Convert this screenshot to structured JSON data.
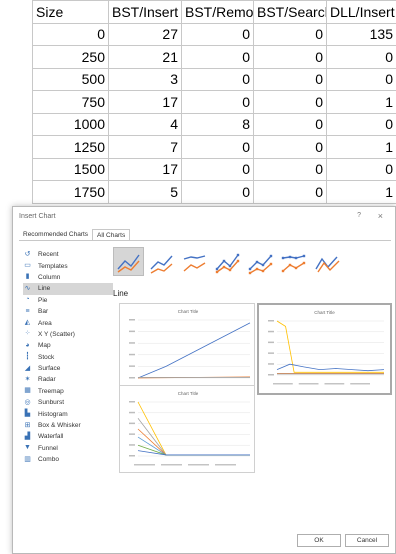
{
  "sheet": {
    "headers": [
      "Size",
      "BST/Insert",
      "BST/Remove",
      "BST/Search",
      "DLL/Insert"
    ],
    "rows": [
      [
        "0",
        "27",
        "0",
        "0",
        "135"
      ],
      [
        "250",
        "21",
        "0",
        "0",
        "0"
      ],
      [
        "500",
        "3",
        "0",
        "0",
        "0"
      ],
      [
        "750",
        "17",
        "0",
        "0",
        "1"
      ],
      [
        "1000",
        "4",
        "8",
        "0",
        "0"
      ],
      [
        "1250",
        "7",
        "0",
        "0",
        "1"
      ],
      [
        "1500",
        "17",
        "0",
        "0",
        "0"
      ],
      [
        "1750",
        "5",
        "0",
        "0",
        "1"
      ]
    ]
  },
  "dialog": {
    "title": "Insert Chart",
    "help": "?",
    "close": "×",
    "tabs": [
      "Recommended Charts",
      "All Charts"
    ],
    "active_tab": 1,
    "categories": [
      {
        "label": "Recent",
        "icon": "recent-icon",
        "glyph": "↺"
      },
      {
        "label": "Templates",
        "icon": "templates-icon",
        "glyph": "▭"
      },
      {
        "label": "Column",
        "icon": "column-chart-icon",
        "glyph": "▮"
      },
      {
        "label": "Line",
        "icon": "line-chart-icon",
        "glyph": "∿"
      },
      {
        "label": "Pie",
        "icon": "pie-chart-icon",
        "glyph": "◔"
      },
      {
        "label": "Bar",
        "icon": "bar-chart-icon",
        "glyph": "≡"
      },
      {
        "label": "Area",
        "icon": "area-chart-icon",
        "glyph": "◭"
      },
      {
        "label": "X Y (Scatter)",
        "icon": "scatter-chart-icon",
        "glyph": "⁘"
      },
      {
        "label": "Map",
        "icon": "map-chart-icon",
        "glyph": "◕"
      },
      {
        "label": "Stock",
        "icon": "stock-chart-icon",
        "glyph": "┇"
      },
      {
        "label": "Surface",
        "icon": "surface-chart-icon",
        "glyph": "◢"
      },
      {
        "label": "Radar",
        "icon": "radar-chart-icon",
        "glyph": "✶"
      },
      {
        "label": "Treemap",
        "icon": "treemap-chart-icon",
        "glyph": "▦"
      },
      {
        "label": "Sunburst",
        "icon": "sunburst-chart-icon",
        "glyph": "◎"
      },
      {
        "label": "Histogram",
        "icon": "histogram-chart-icon",
        "glyph": "▙"
      },
      {
        "label": "Box & Whisker",
        "icon": "box-whisker-chart-icon",
        "glyph": "⊞"
      },
      {
        "label": "Waterfall",
        "icon": "waterfall-chart-icon",
        "glyph": "▟"
      },
      {
        "label": "Funnel",
        "icon": "funnel-chart-icon",
        "glyph": "▼"
      },
      {
        "label": "Combo",
        "icon": "combo-chart-icon",
        "glyph": "▥"
      }
    ],
    "active_category": 3,
    "subtype_title": "Line",
    "preview_title": "Chart Title",
    "ok": "OK",
    "cancel": "Cancel",
    "colors": {
      "accent_blue": "#4472c4",
      "orange": "#ed7d31",
      "gray": "#a5a5a5",
      "yellow": "#ffc000",
      "light_blue": "#5b9bd5",
      "green": "#70ad47",
      "selected_bg": "#d6d6d6",
      "annotation_red": "#e02020"
    }
  }
}
